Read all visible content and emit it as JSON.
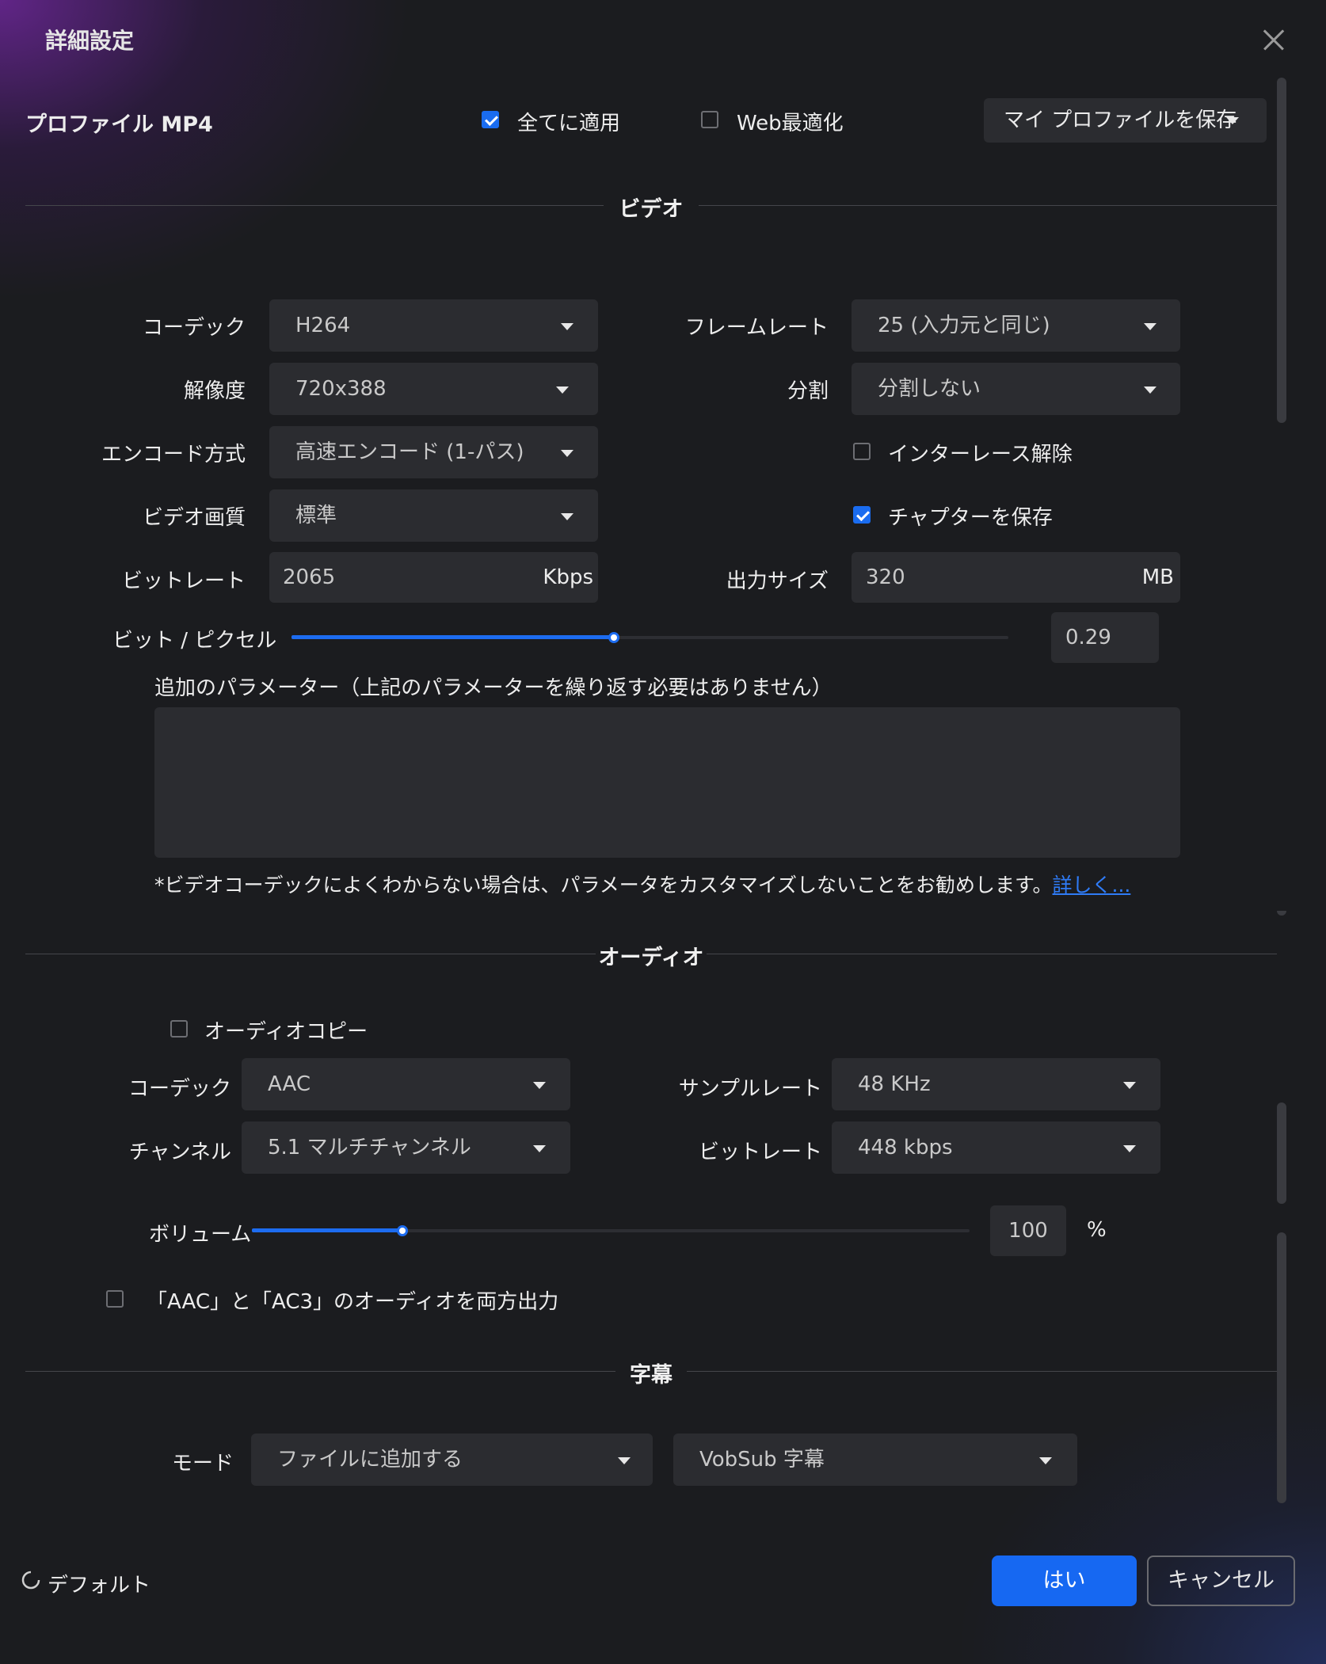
{
  "dialog": {
    "title": "詳細設定"
  },
  "profile": {
    "label": "プロファイル MP4",
    "apply_all": {
      "label": "全てに適用",
      "checked": true
    },
    "web_optimize": {
      "label": "Web最適化",
      "checked": false
    },
    "save_profile": "マイ プロファイルを保存"
  },
  "video": {
    "section_title": "ビデオ",
    "codec": {
      "label": "コーデック",
      "value": "H264"
    },
    "resolution": {
      "label": "解像度",
      "value": "720x388"
    },
    "encode_mode": {
      "label": "エンコード方式",
      "value": "高速エンコード (1-パス)"
    },
    "quality": {
      "label": "ビデオ画質",
      "value": "標準"
    },
    "bitrate": {
      "label": "ビットレート",
      "value": "2065",
      "unit": "Kbps"
    },
    "framerate": {
      "label": "フレームレート",
      "value": "25 (入力元と同じ)"
    },
    "split": {
      "label": "分割",
      "value": "分割しない"
    },
    "deinterlace": {
      "label": "インターレース解除",
      "checked": false
    },
    "keep_chapters": {
      "label": "チャプターを保存",
      "checked": true
    },
    "output_size": {
      "label": "出力サイズ",
      "value": "320",
      "unit": "MB"
    },
    "bits_per_pixel": {
      "label": "ビット / ピクセル",
      "value": "0.29",
      "slider_fraction": 0.45
    },
    "extra_params": {
      "label": "追加のパラメーター（上記のパラメーターを繰り返す必要はありません）",
      "value": ""
    },
    "note": "*ビデオコーデックによくわからない場合は、パラメータをカスタマイズしないことをお勧めします。",
    "more_link": "詳しく..."
  },
  "audio": {
    "section_title": "オーディオ",
    "audio_copy": {
      "label": "オーディオコピー",
      "checked": false
    },
    "codec": {
      "label": "コーデック",
      "value": "AAC"
    },
    "channel": {
      "label": "チャンネル",
      "value": "5.1 マルチチャンネル"
    },
    "sample_rate": {
      "label": "サンプルレート",
      "value": "48 KHz"
    },
    "bitrate": {
      "label": "ビットレート",
      "value": "448 kbps"
    },
    "volume": {
      "label": "ボリューム",
      "value": "100",
      "unit": "%",
      "slider_fraction": 0.21
    },
    "dual_output": {
      "label": "「AAC」と「AC3」のオーディオを両方出力",
      "checked": false
    }
  },
  "subtitle": {
    "section_title": "字幕",
    "mode": {
      "label": "モード",
      "value": "ファイルに追加する"
    },
    "format": {
      "value": "VobSub 字幕"
    }
  },
  "footer": {
    "default": "デフォルト",
    "ok": "はい",
    "cancel": "キャンセル"
  },
  "colors": {
    "accent": "#1668f2",
    "background": "#1b1c1f",
    "field": "#2b2c30"
  }
}
